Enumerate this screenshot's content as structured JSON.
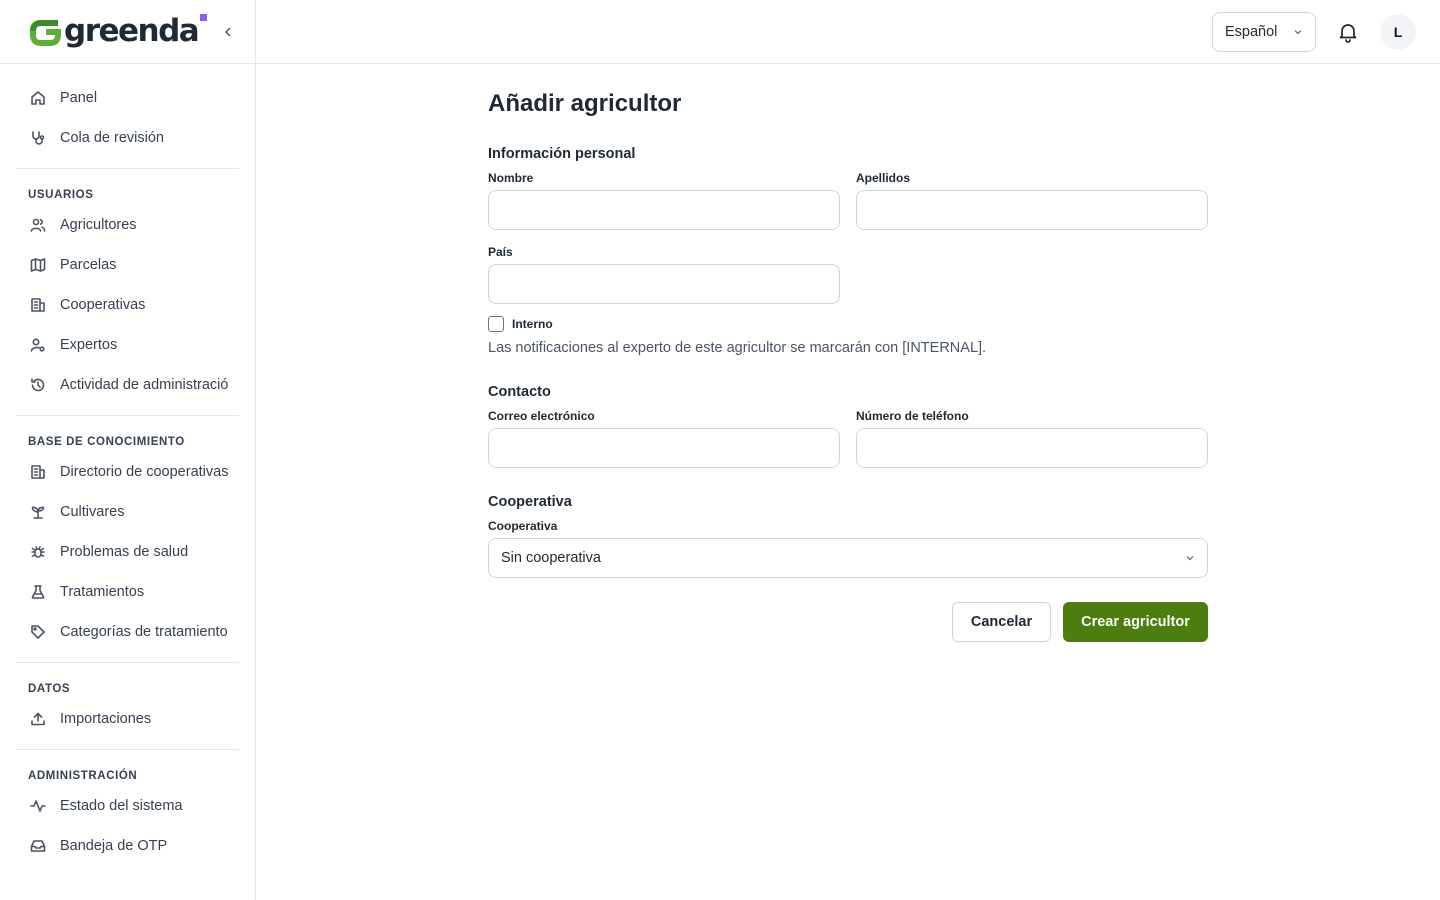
{
  "brand": {
    "name": "greenda",
    "logo_icon": "greenda-logo-icon",
    "accent": "#4d7c0f",
    "logo_green": "#5fae3a",
    "logo_dot": "#8b5cf6"
  },
  "sidebar": {
    "collapse_icon": "chevron-left-icon",
    "top_items": [
      {
        "label": "Panel",
        "icon": "home-icon"
      },
      {
        "label": "Cola de revisión",
        "icon": "stethoscope-icon"
      }
    ],
    "groups": [
      {
        "title": "USUARIOS",
        "items": [
          {
            "label": "Agricultores",
            "icon": "users-icon"
          },
          {
            "label": "Parcelas",
            "icon": "map-icon"
          },
          {
            "label": "Cooperativas",
            "icon": "building-icon"
          },
          {
            "label": "Expertos",
            "icon": "user-cog-icon"
          },
          {
            "label": "Actividad de administración",
            "icon": "history-icon"
          }
        ]
      },
      {
        "title": "BASE DE CONOCIMIENTO",
        "items": [
          {
            "label": "Directorio de cooperativas",
            "icon": "building-icon"
          },
          {
            "label": "Cultivares",
            "icon": "sprout-icon"
          },
          {
            "label": "Problemas de salud",
            "icon": "bug-icon"
          },
          {
            "label": "Tratamientos",
            "icon": "flask-icon"
          },
          {
            "label": "Categorías de tratamiento",
            "icon": "tag-icon"
          }
        ]
      },
      {
        "title": "DATOS",
        "items": [
          {
            "label": "Importaciones",
            "icon": "upload-icon"
          }
        ]
      },
      {
        "title": "ADMINISTRACIÓN",
        "items": [
          {
            "label": "Estado del sistema",
            "icon": "activity-icon"
          },
          {
            "label": "Bandeja de OTP",
            "icon": "inbox-icon"
          }
        ]
      }
    ]
  },
  "topbar": {
    "language": "Español",
    "notifications_icon": "bell-icon",
    "avatar_initial": "L"
  },
  "form": {
    "title": "Añadir agricultor",
    "personal_section": "Información personal",
    "first_name_label": "Nombre",
    "first_name_value": "",
    "last_name_label": "Apellidos",
    "last_name_value": "",
    "country_label": "País",
    "country_value": "",
    "internal_label": "Interno",
    "internal_checked": false,
    "internal_hint": "Las notificaciones al experto de este agricultor se marcarán con [INTERNAL].",
    "contact_section": "Contacto",
    "email_label": "Correo electrónico",
    "email_value": "",
    "phone_label": "Número de teléfono",
    "phone_value": "",
    "coop_section": "Cooperativa",
    "coop_label": "Cooperativa",
    "coop_value": "Sin cooperativa",
    "cancel_label": "Cancelar",
    "submit_label": "Crear agricultor"
  }
}
